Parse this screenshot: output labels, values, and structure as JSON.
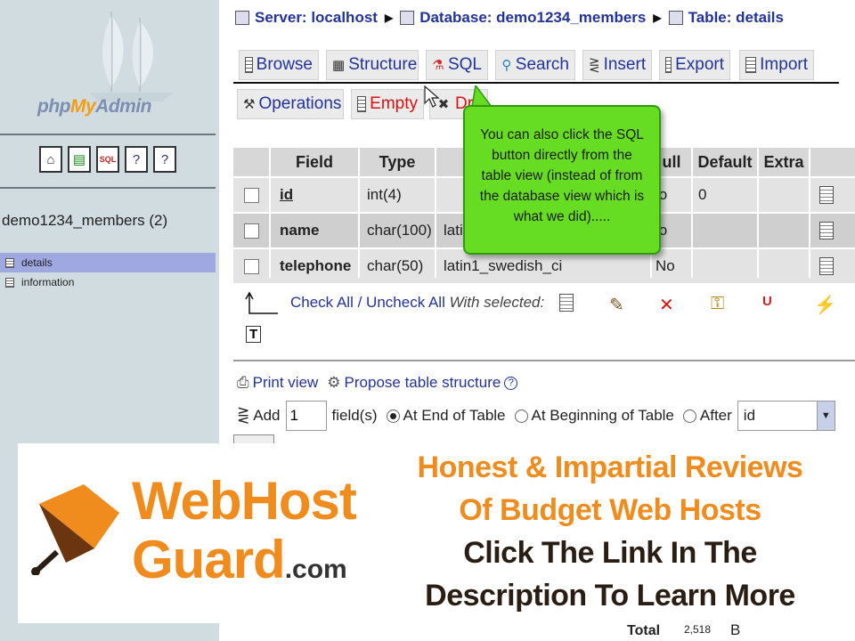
{
  "left_panel": {
    "logo": {
      "php": "php",
      "my": "My",
      "admin": "Admin"
    },
    "nav_icons": [
      "home-icon",
      "query-icon",
      "sql-icon",
      "docs-icon",
      "changelog-icon"
    ],
    "db_name": "demo1234_members (2)",
    "tables": [
      {
        "label": "details",
        "selected": true
      },
      {
        "label": "information",
        "selected": false
      }
    ]
  },
  "breadcrumb": {
    "server": "Server: localhost",
    "database": "Database: demo1234_members",
    "table": "Table: details"
  },
  "tabs": {
    "browse": "Browse",
    "structure": "Structure",
    "sql": "SQL",
    "search": "Search",
    "insert": "Insert",
    "export": "Export",
    "import": "Import",
    "operations": "Operations",
    "empty": "Empty",
    "drop": "Dr"
  },
  "fields_table": {
    "headers": {
      "field": "Field",
      "type": "Type",
      "null": "ull",
      "default": "Default",
      "extra": "Extra"
    },
    "rows": [
      {
        "field": "id",
        "type": "int(4)",
        "collation": "",
        "null": "lo",
        "default": "0"
      },
      {
        "field": "name",
        "type": "char(100)",
        "collation": "lati",
        "null": "lo",
        "default": ""
      },
      {
        "field": "telephone",
        "type": "char(50)",
        "collation": "latin1_swedish_ci",
        "null": "No",
        "default": ""
      }
    ]
  },
  "bulk": {
    "check_all": "Check All",
    "slash": " / ",
    "uncheck_all": "Uncheck All",
    "with_selected": "With selected:"
  },
  "tools": {
    "print_view": "Print view",
    "propose": "Propose table structure"
  },
  "add_fields": {
    "add": "Add",
    "count": "1",
    "fields_label": "field(s)",
    "end": "At End of Table",
    "beginning": "At Beginning of Table",
    "after": "After",
    "after_value": "id"
  },
  "tooltip": {
    "line1": "You can also click the SQL",
    "line2": "button directly from the",
    "line3": "table view (instead of from",
    "line4": "the database view which is",
    "line5": "what we did)....."
  },
  "footer": {
    "total_label": "Total",
    "total_size": "2,518",
    "total_unit": "B"
  },
  "banner": {
    "brand_line1": "WebHost",
    "brand_line2": "Guard",
    "brand_suffix": ".com",
    "line1": "Honest & Impartial Reviews",
    "line2": "Of Budget Web Hosts",
    "line3": "Click The Link In The",
    "line4": "Description To Learn More"
  },
  "colors": {
    "link": "#233399",
    "brand_orange": "#f08c1e",
    "tooltip_green": "#66dd22",
    "danger": "#dd1111"
  }
}
